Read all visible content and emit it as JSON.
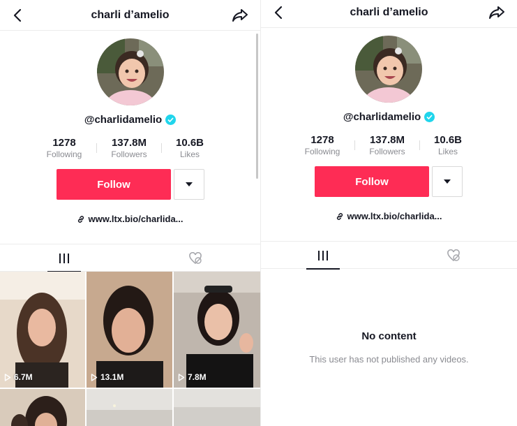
{
  "profile": {
    "header_title": "charli d’amelio",
    "username": "@charlidamelio",
    "following_count": "1278",
    "following_label": "Following",
    "followers_count": "137.8M",
    "followers_label": "Followers",
    "likes_count": "10.6B",
    "likes_label": "Likes",
    "follow_label": "Follow",
    "bio_link": "www.ltx.bio/charlida..."
  },
  "icons": {
    "back": "chevron-left-icon",
    "share": "share-arrow-icon",
    "verified": "verified-check-icon",
    "link": "link-icon",
    "videos_tab": "videos-grid-icon",
    "liked_tab": "liked-heart-hidden-icon",
    "play": "play-icon"
  },
  "videos": [
    {
      "views": "6.7M"
    },
    {
      "views": "13.1M"
    },
    {
      "views": "7.8M"
    }
  ],
  "empty_state": {
    "title": "No content",
    "subtitle": "This user has not published any videos."
  },
  "colors": {
    "accent": "#fe2c55",
    "verified": "#20d5ec"
  }
}
